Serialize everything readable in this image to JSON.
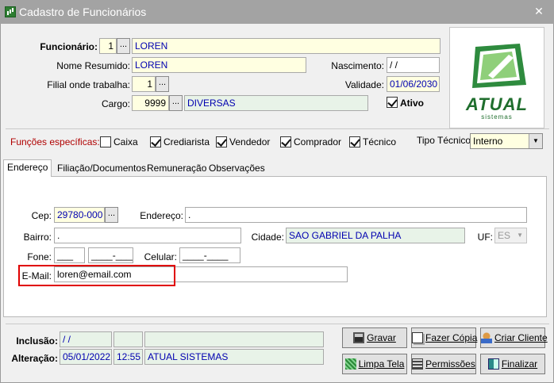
{
  "window": {
    "title": "Cadastro de Funcionários",
    "close_glyph": "✕"
  },
  "header": {
    "funcionario_label": "Funcionário:",
    "funcionario_code": "1",
    "funcionario_name": "LOREN",
    "nome_resumido_label": "Nome Resumido:",
    "nome_resumido_value": "LOREN",
    "filial_label": "Filial onde trabalha:",
    "filial_value": "1",
    "cargo_label": "Cargo:",
    "cargo_code": "9999",
    "cargo_name": "DIVERSAS",
    "nascimento_label": "Nascimento:",
    "nascimento_value": " /  /",
    "validade_label": "Validade:",
    "validade_value": "01/06/2030",
    "ativo_label": "Ativo",
    "ativo_checked": true,
    "lookup_glyph": "..."
  },
  "logo": {
    "brand": "ATUAL",
    "sub": "sistemas"
  },
  "funcoes": {
    "label": "Funções específicas:",
    "label_color": "#b00000",
    "items": [
      {
        "label": "Caixa",
        "checked": false
      },
      {
        "label": "Crediarista",
        "checked": true
      },
      {
        "label": "Vendedor",
        "checked": true
      },
      {
        "label": "Comprador",
        "checked": true
      },
      {
        "label": "Técnico",
        "checked": true
      }
    ],
    "tipo_tecnico_label": "Tipo Técnico:",
    "tipo_tecnico_value": "Interno",
    "dropdown_glyph": "▼"
  },
  "tabs": [
    {
      "label": "Endereço",
      "active": true
    },
    {
      "label": "Filiação/Documentos",
      "active": false
    },
    {
      "label": "Remuneração",
      "active": false
    },
    {
      "label": "Observações",
      "active": false
    }
  ],
  "endereco": {
    "cep_label": "Cep:",
    "cep_value": "29780-000",
    "endereco_label": "Endereço:",
    "endereco_value": ".",
    "bairro_label": "Bairro:",
    "bairro_value": ".",
    "cidade_label": "Cidade:",
    "cidade_value": "SAO GABRIEL DA PALHA",
    "uf_label": "UF:",
    "uf_value": "ES",
    "fone_label": "Fone:",
    "fone_ddd": "___",
    "fone_num": "____-____",
    "celular_label": "Celular:",
    "celular_num": "____-____",
    "email_label": "E-Mail:",
    "email_value": "loren@email.com"
  },
  "footer": {
    "inclusao_label": "Inclusão:",
    "inclusao_date": " /  /",
    "alteracao_label": "Alteração:",
    "alteracao_date": "05/01/2022",
    "alteracao_time": "12:55",
    "alteracao_user": "ATUAL SISTEMAS"
  },
  "buttons": {
    "gravar": "Gravar",
    "fazer_copia": "Fazer Cópia",
    "criar_cliente": "Criar Cliente",
    "limpa_tela": "Limpa Tela",
    "permissoes": "Permissões",
    "finalizar": "Finalizar"
  }
}
